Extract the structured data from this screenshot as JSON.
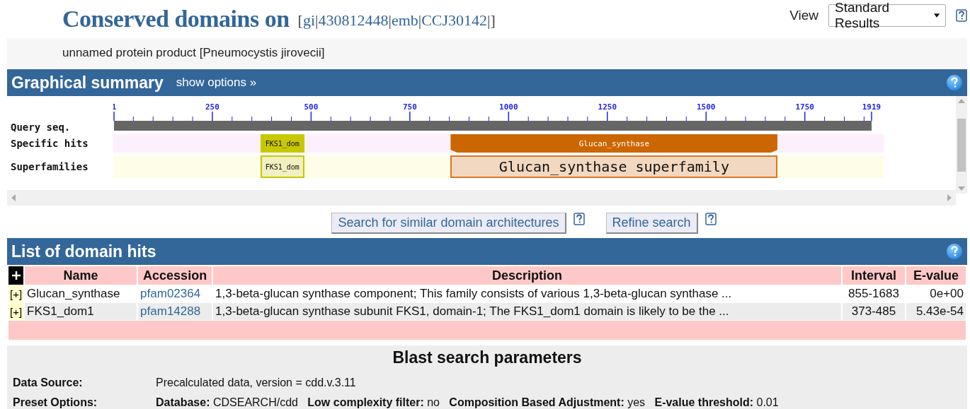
{
  "header": {
    "title": "Conserved domains on",
    "query_parts": [
      "[",
      "gi",
      "|",
      "430812448",
      "|",
      "emb",
      "|",
      "CCJ30142",
      "|]"
    ],
    "view_label": "View",
    "view_select": "Standard Results",
    "subtitle": "unnamed protein product [Pneumocystis jirovecii]"
  },
  "graphical_summary": {
    "title": "Graphical summary",
    "show_options": "show options »",
    "ruler_ticks": [
      "1",
      "250",
      "500",
      "750",
      "1000",
      "1250",
      "1500",
      "1750",
      "1919"
    ],
    "tracks": [
      {
        "label": "Query seq.",
        "kind": "query"
      },
      {
        "label": "Specific hits",
        "kind": "specific",
        "hits": [
          {
            "label": "FKS1_dom",
            "color": "#c8c800"
          },
          {
            "label": "Glucan_synthase",
            "color": "#cc6600"
          }
        ]
      },
      {
        "label": "Superfamilies",
        "kind": "superfamily",
        "hits": [
          {
            "label": "FKS1_dom",
            "color": "#c8c800"
          },
          {
            "label": "Glucan_synthase superfamily",
            "color": "#dd7722"
          }
        ]
      }
    ],
    "buttons": [
      "Search for similar domain architectures",
      "Refine search"
    ]
  },
  "domain_hits": {
    "title": "List of domain hits",
    "columns": [
      "Name",
      "Accession",
      "Description",
      "Interval",
      "E-value"
    ],
    "rows": [
      {
        "expander": "[+]",
        "name": "Glucan_synthase",
        "accession": "pfam02364",
        "description": "1,3-beta-glucan synthase component; This family consists of various 1,3-beta-glucan synthase ...",
        "interval": "855-1683",
        "evalue": "0e+00"
      },
      {
        "expander": "[+]",
        "name": "FKS1_dom1",
        "accession": "pfam14288",
        "description": "1,3-beta-glucan synthase subunit FKS1, domain-1; The FKS1_dom1 domain is likely to be the ...",
        "interval": "373-485",
        "evalue": "5.43e-54"
      }
    ]
  },
  "blast_parameters": {
    "title": "Blast search parameters",
    "rows": [
      {
        "label": "Data Source:",
        "value": "Precalculated data, version = cdd.v.3.11"
      },
      {
        "label": "Preset Options:",
        "value": "**Database:** CDSEARCH/cdd   **Low complexity filter:** no   **Composition Based Adjustment:** yes   **E-value threshold:** 0.01"
      }
    ]
  }
}
